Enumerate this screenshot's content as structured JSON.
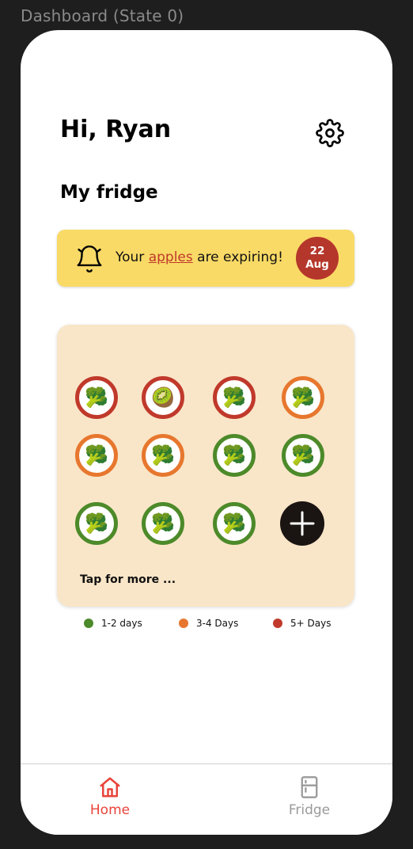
{
  "frame": {
    "label": "Dashboard (State 0)"
  },
  "header": {
    "greeting": "Hi, Ryan",
    "settings_icon": "gear-icon"
  },
  "section": {
    "title": "My fridge"
  },
  "alert": {
    "icon": "bell-icon",
    "prefix": "Your ",
    "item": "apples",
    "suffix": " are expiring!",
    "date_day": "22",
    "date_month": "Aug",
    "color": "#f9da66",
    "badge_color": "#b5362b"
  },
  "fridge": {
    "items": [
      {
        "emoji": "🥦",
        "status": "red"
      },
      {
        "emoji": "🥝",
        "status": "red"
      },
      {
        "emoji": "🥦",
        "status": "red"
      },
      {
        "emoji": "🥦",
        "status": "orange"
      },
      {
        "emoji": "🥦",
        "status": "orange"
      },
      {
        "emoji": "🥦",
        "status": "orange"
      },
      {
        "emoji": "🥦",
        "status": "green"
      },
      {
        "emoji": "🥦",
        "status": "green"
      },
      {
        "emoji": "🥦",
        "status": "green"
      },
      {
        "emoji": "🥦",
        "status": "green"
      },
      {
        "emoji": "🥦",
        "status": "green"
      }
    ],
    "add_icon": "plus-icon",
    "tap_more": "Tap for more ..."
  },
  "legend": [
    {
      "label": "1-2 days",
      "color": "#4d8a2a"
    },
    {
      "label": "3-4 Days",
      "color": "#e7772e"
    },
    {
      "label": "5+ Days",
      "color": "#c0392b"
    }
  ],
  "tabs": [
    {
      "label": "Home",
      "icon": "home-icon",
      "active": true,
      "color": "#e8443a"
    },
    {
      "label": "Fridge",
      "icon": "fridge-icon",
      "active": false,
      "color": "#9a9a9a"
    }
  ]
}
